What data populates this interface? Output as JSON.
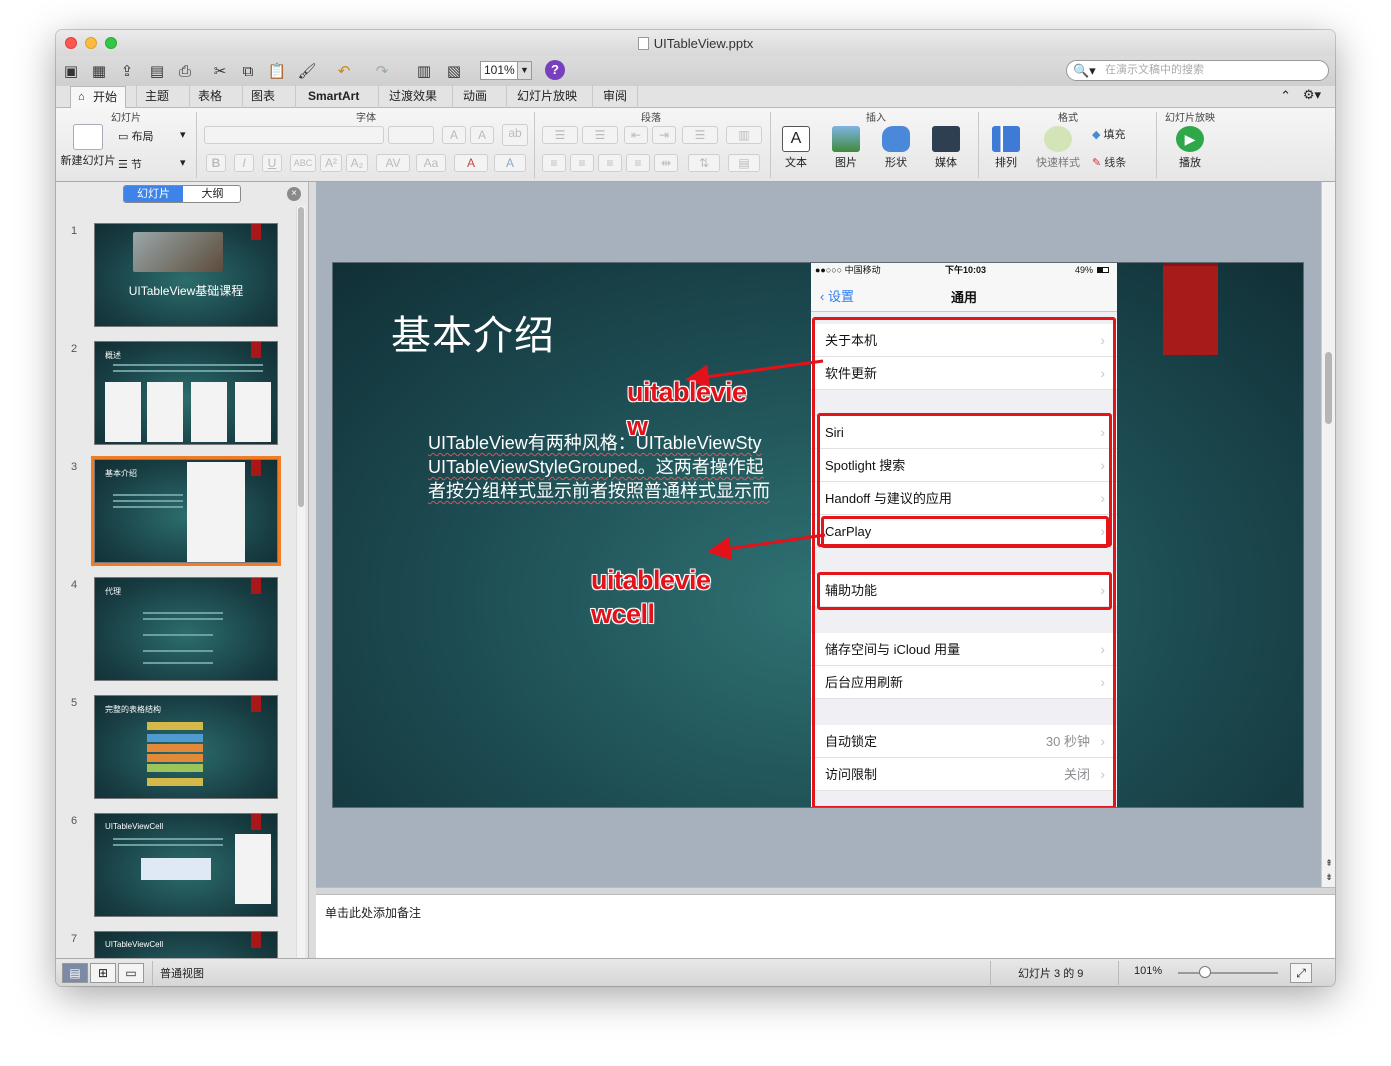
{
  "window": {
    "title": "UITableView.pptx"
  },
  "toolbar": {
    "zoom": "101%",
    "help": "?",
    "search_placeholder": "在演示文稿中的搜索"
  },
  "tabs": [
    "开始",
    "主题",
    "表格",
    "图表",
    "SmartArt",
    "过渡效果",
    "动画",
    "幻灯片放映",
    "审阅"
  ],
  "ribbon": {
    "groups": {
      "slides": "幻灯片",
      "font": "字体",
      "paragraph": "段落",
      "insert": "插入",
      "format": "格式",
      "slideshow": "幻灯片放映"
    },
    "new_slide": "新建幻灯片",
    "layout": "布局",
    "section": "节",
    "text": "文本",
    "picture": "图片",
    "shape": "形状",
    "media": "媒体",
    "arrange": "排列",
    "quick_style": "快速样式",
    "fill": "填充",
    "line": "线条",
    "play": "播放"
  },
  "left_pane": {
    "tab_slides": "幻灯片",
    "tab_outline": "大纲"
  },
  "thumbnails": [
    {
      "num": "1",
      "title": "UITableView基础课程"
    },
    {
      "num": "2",
      "title": "概述"
    },
    {
      "num": "3",
      "title": "基本介绍"
    },
    {
      "num": "4",
      "title": "代理"
    },
    {
      "num": "5",
      "title": "完整的表格结构"
    },
    {
      "num": "6",
      "title": "UITableViewCell"
    },
    {
      "num": "7",
      "title": "UITableViewCell"
    }
  ],
  "slide": {
    "title": "基本介绍",
    "body_lines": [
      "UITableView有两种风格：UITableViewSty",
      "UITableViewStyleGrouped。这两者操作起",
      "者按分组样式显示前者按照普通样式显示而"
    ],
    "annotation_1": "uitablevie\nw",
    "annotation_2": "uitablevie\nwcell",
    "accent": "#e3121a"
  },
  "phone": {
    "carrier": "●●○○○ 中国移动",
    "time": "下午10:03",
    "battery": "49%",
    "back": "设置",
    "nav_title": "通用",
    "cells": {
      "about": "关于本机",
      "update": "软件更新",
      "siri": "Siri",
      "spotlight": "Spotlight 搜索",
      "handoff": "Handoff 与建议的应用",
      "carplay": "CarPlay",
      "accessibility": "辅助功能",
      "storage": "储存空间与 iCloud 用量",
      "background": "后台应用刷新",
      "autolock": "自动锁定",
      "autolock_value": "30 秒钟",
      "restrictions": "访问限制",
      "restrictions_value": "关闭"
    }
  },
  "notes": {
    "placeholder": "单击此处添加备注"
  },
  "status": {
    "view": "普通视图",
    "slide_info": "幻灯片 3 的 9",
    "zoom": "101%"
  }
}
